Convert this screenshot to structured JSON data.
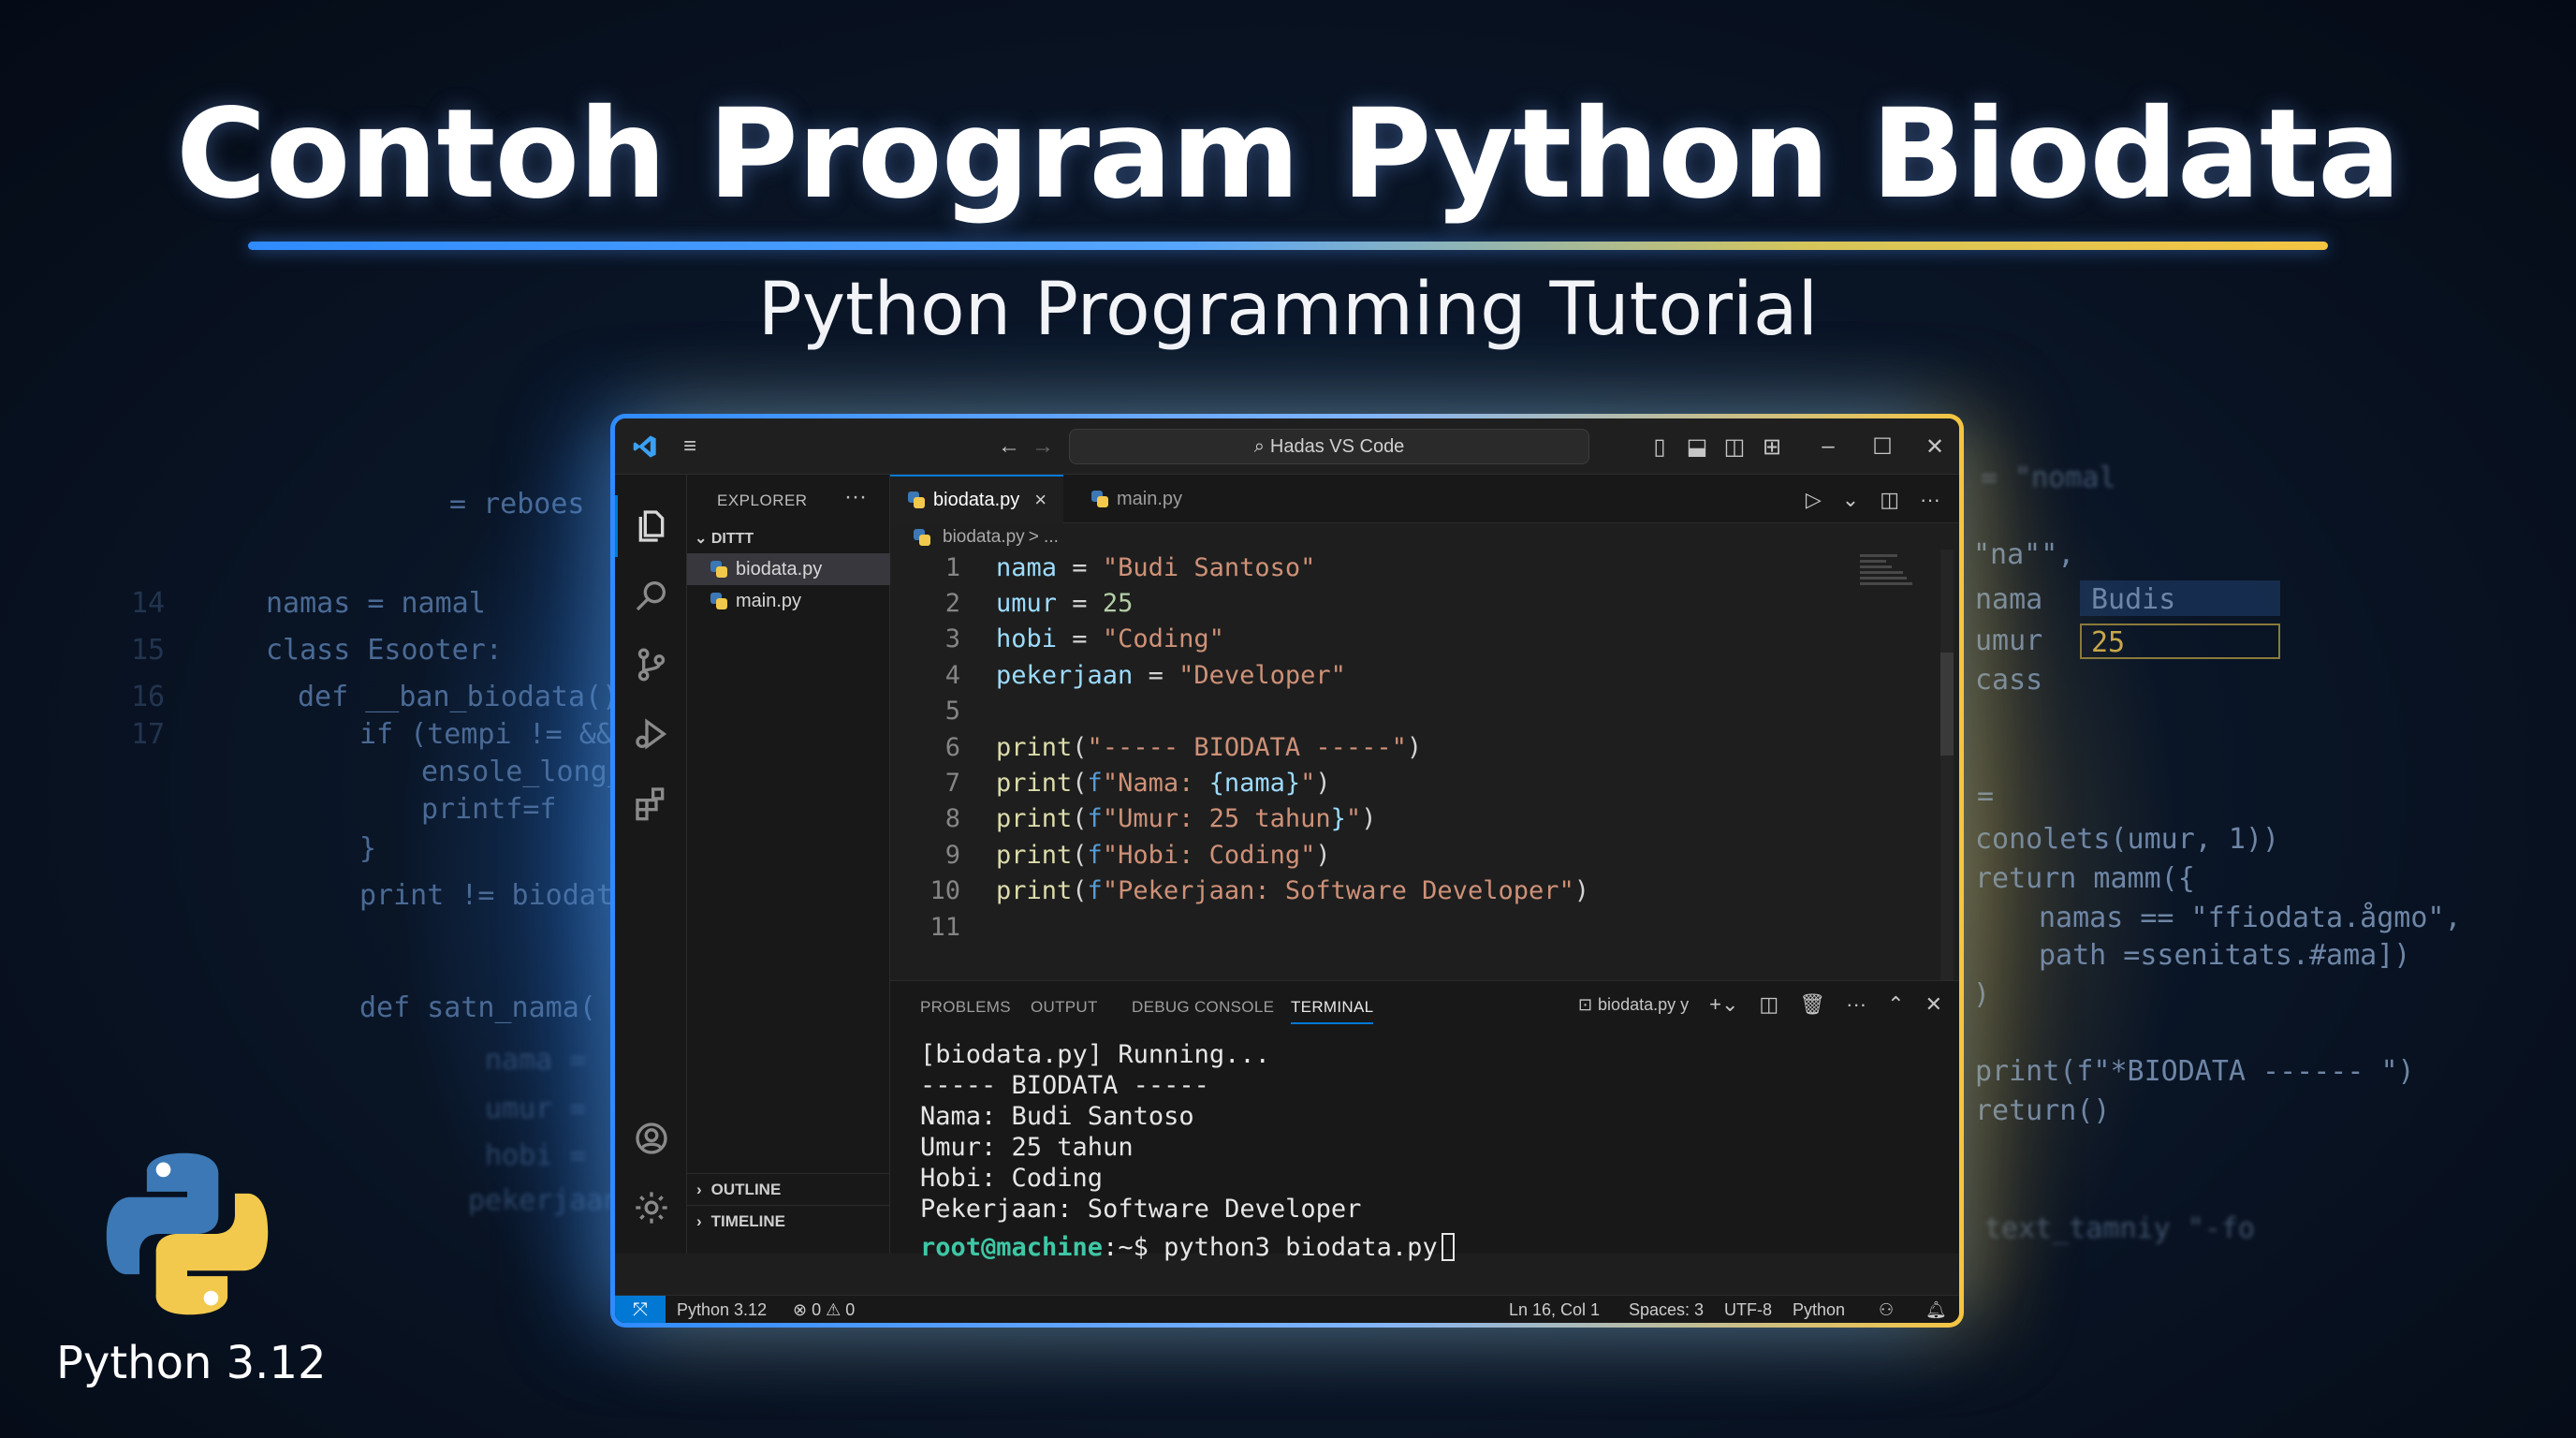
{
  "header": {
    "title": "Contoh Program Python Biodata",
    "subtitle": "Python Programming Tutorial"
  },
  "background_code": {
    "left": [
      {
        "ln": "",
        "text": "= reboes"
      },
      {
        "ln": "14",
        "text": "namas = namal"
      },
      {
        "ln": "15",
        "text": "class Esooter:"
      },
      {
        "ln": "16",
        "text": "  def __ban_biodata():"
      },
      {
        "ln": "17",
        "text": "    if (tempi != &&."
      },
      {
        "ln": "",
        "text": "        ensole_long_"
      },
      {
        "ln": "",
        "text": "        printf=f"
      },
      {
        "ln": "",
        "text": "    }"
      },
      {
        "ln": "",
        "text": "    print != biodata"
      },
      {
        "ln": "",
        "text": "  def satn_nama("
      },
      {
        "ln": "",
        "text": "nama ="
      },
      {
        "ln": "",
        "text": "umur ="
      },
      {
        "ln": "",
        "text": "hobi ="
      },
      {
        "ln": "",
        "text": "pekerjaan"
      }
    ],
    "right": [
      "= \"nomal",
      "\"na\"\",",
      "nama",
      "umur",
      "cass",
      "=",
      "conolets(umur, 1))",
      "return mamm({",
      "    namas == \"ffiodata.ågmo\",",
      "    path =ssenitats.#ama])",
      ")",
      "print(f\"*BIODATA ------ \")",
      "return()",
      "text_tamniy \"-fo"
    ],
    "right_field_values": [
      "Budis",
      "25"
    ]
  },
  "window": {
    "search": "Hadas VS Code",
    "sidebar": {
      "header": "EXPLORER",
      "more": "···",
      "folder": "DITTT",
      "files": [
        "biodata.py",
        "main.py"
      ],
      "sections": [
        "OUTLINE",
        "TIMELINE"
      ]
    },
    "tabs": [
      {
        "label": "biodata.py",
        "active": true,
        "close": "×"
      },
      {
        "label": "main.py",
        "active": false
      }
    ],
    "breadcrumb": {
      "file": "biodata.py",
      "rest": "> ..."
    },
    "code_lines": [
      {
        "ln": "1",
        "tokens": [
          [
            "c-var",
            "nama"
          ],
          [
            "c-op",
            " = "
          ],
          [
            "c-str",
            "\"Budi Santoso\""
          ]
        ]
      },
      {
        "ln": "2",
        "tokens": [
          [
            "c-var",
            "umur"
          ],
          [
            "c-op",
            " = "
          ],
          [
            "c-num",
            "25"
          ]
        ]
      },
      {
        "ln": "3",
        "tokens": [
          [
            "c-var",
            "hobi"
          ],
          [
            "c-op",
            " = "
          ],
          [
            "c-str",
            "\"Coding\""
          ]
        ]
      },
      {
        "ln": "4",
        "tokens": [
          [
            "c-var",
            "pekerjaan"
          ],
          [
            "c-op",
            " = "
          ],
          [
            "c-str",
            "\"Developer\""
          ]
        ]
      },
      {
        "ln": "5",
        "tokens": []
      },
      {
        "ln": "6",
        "tokens": [
          [
            "c-fn",
            "print"
          ],
          [
            "c-op",
            "("
          ],
          [
            "c-str",
            "\"----- BIODATA -----\""
          ],
          [
            "c-op",
            ")"
          ]
        ]
      },
      {
        "ln": "7",
        "tokens": [
          [
            "c-fn",
            "print"
          ],
          [
            "c-op",
            "("
          ],
          [
            "c-f",
            "f"
          ],
          [
            "c-str",
            "\"Nama: "
          ],
          [
            "c-var",
            "{nama}"
          ],
          [
            "c-str",
            "\""
          ],
          [
            "c-op",
            ")"
          ]
        ]
      },
      {
        "ln": "8",
        "tokens": [
          [
            "c-fn",
            "print"
          ],
          [
            "c-op",
            "("
          ],
          [
            "c-f",
            "f"
          ],
          [
            "c-str",
            "\"Umur: 25 tahun"
          ],
          [
            "c-var",
            "}"
          ],
          [
            "c-str",
            "\""
          ],
          [
            "c-op",
            ")"
          ]
        ]
      },
      {
        "ln": "9",
        "tokens": [
          [
            "c-fn",
            "print"
          ],
          [
            "c-op",
            "("
          ],
          [
            "c-f",
            "f"
          ],
          [
            "c-str",
            "\"Hobi: Coding\""
          ],
          [
            "c-op",
            ")"
          ]
        ]
      },
      {
        "ln": "10",
        "tokens": [
          [
            "c-fn",
            "print"
          ],
          [
            "c-op",
            "("
          ],
          [
            "c-f",
            "f"
          ],
          [
            "c-str",
            "\"Pekerjaan: Software Developer\""
          ],
          [
            "c-op",
            ")"
          ]
        ]
      },
      {
        "ln": "11",
        "tokens": []
      }
    ],
    "panel": {
      "tabs": [
        "PROBLEMS",
        "OUTPUT",
        "DEBUG CONSOLE",
        "TERMINAL"
      ],
      "active_tab": "TERMINAL",
      "terminal_name": "biodata.py y",
      "output": [
        "[biodata.py] Running...",
        "----- BIODATA -----",
        "Nama: Budi Santoso",
        "Umur: 25 tahun",
        "Hobi: Coding",
        "Pekerjaan: Software Developer"
      ],
      "prompt_user": "root@machine",
      "prompt_rest": ":~$ python3 biodata.py"
    },
    "statusbar": {
      "python": "Python 3.12",
      "problems": "⊗ 0 ⚠ 0",
      "position": "Ln 16, Col 1",
      "spaces": "Spaces: 3",
      "encoding": "UTF-8",
      "language": "Python"
    }
  },
  "badge": {
    "caption": "Python 3.12"
  },
  "colors": {
    "accent_blue": "#2f8bff",
    "accent_yellow": "#f5c542",
    "vscode_blue": "#0078d4"
  }
}
